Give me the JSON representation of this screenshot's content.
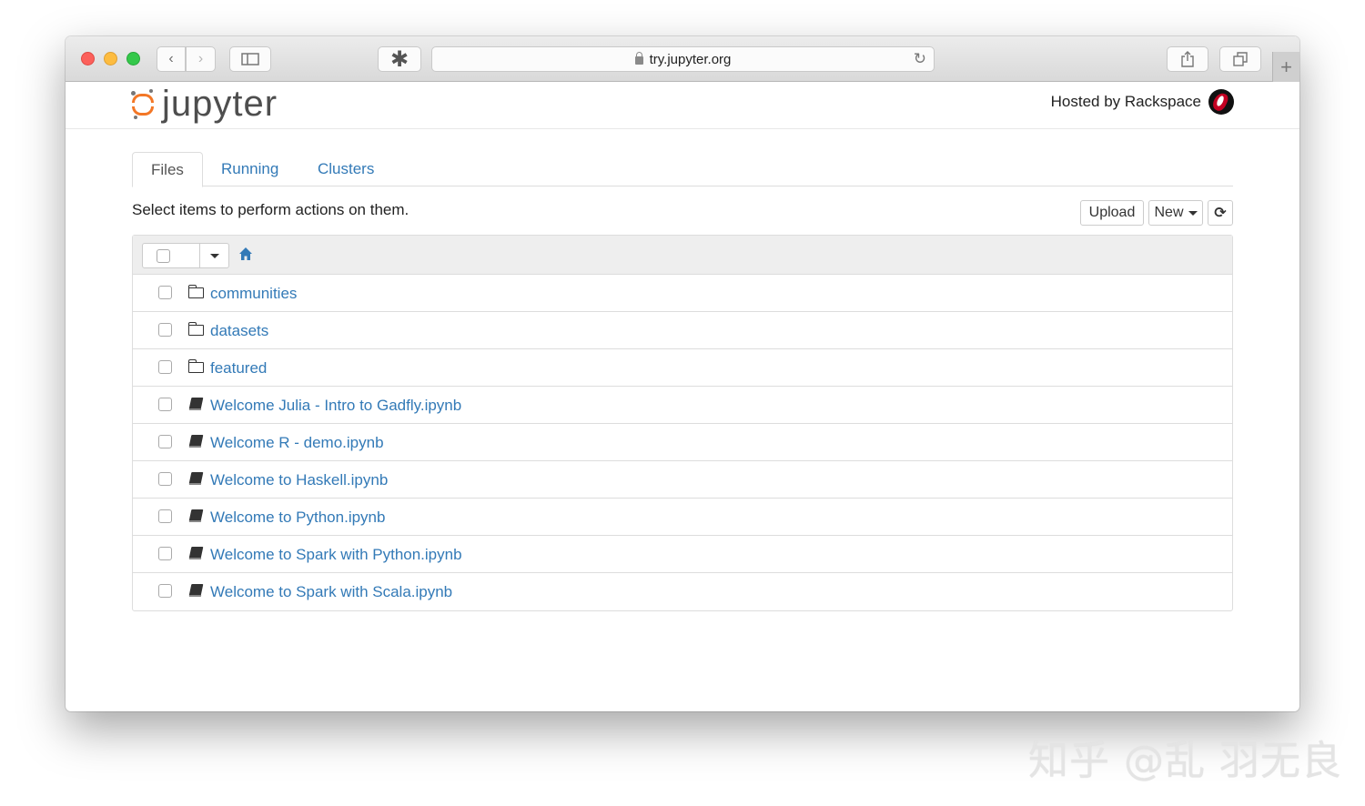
{
  "browser": {
    "url": "try.jupyter.org"
  },
  "header": {
    "logo_text": "jupyter",
    "hosted_by": "Hosted by Rackspace"
  },
  "tabs": [
    {
      "label": "Files"
    },
    {
      "label": "Running"
    },
    {
      "label": "Clusters"
    }
  ],
  "toolbar": {
    "hint": "Select items to perform actions on them.",
    "upload_label": "Upload",
    "new_label": "New"
  },
  "files": [
    {
      "name": "communities",
      "type": "folder"
    },
    {
      "name": "datasets",
      "type": "folder"
    },
    {
      "name": "featured",
      "type": "folder"
    },
    {
      "name": "Welcome Julia - Intro to Gadfly.ipynb",
      "type": "notebook"
    },
    {
      "name": "Welcome R - demo.ipynb",
      "type": "notebook"
    },
    {
      "name": "Welcome to Haskell.ipynb",
      "type": "notebook"
    },
    {
      "name": "Welcome to Python.ipynb",
      "type": "notebook"
    },
    {
      "name": "Welcome to Spark with Python.ipynb",
      "type": "notebook"
    },
    {
      "name": "Welcome to Spark with Scala.ipynb",
      "type": "notebook"
    }
  ],
  "watermark": "知乎 @乱 羽无良",
  "colors": {
    "link": "#337ab7",
    "jupyter_orange": "#f37726"
  }
}
